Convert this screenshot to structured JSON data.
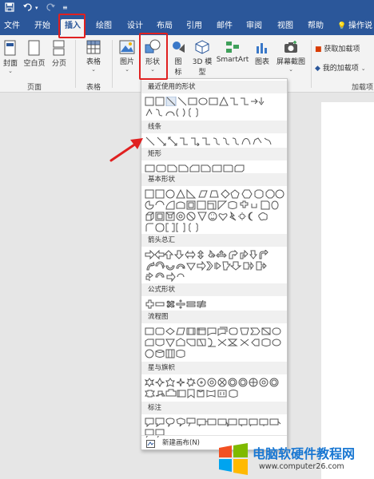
{
  "titlebar": {
    "icons": [
      "save-icon",
      "undo-icon",
      "redo-icon",
      "customize-icon"
    ]
  },
  "tabs": [
    {
      "label": "文件",
      "active": false
    },
    {
      "label": "开始",
      "active": false
    },
    {
      "label": "插入",
      "active": true
    },
    {
      "label": "绘图",
      "active": false
    },
    {
      "label": "设计",
      "active": false
    },
    {
      "label": "布局",
      "active": false
    },
    {
      "label": "引用",
      "active": false
    },
    {
      "label": "邮件",
      "active": false
    },
    {
      "label": "审阅",
      "active": false
    },
    {
      "label": "视图",
      "active": false
    },
    {
      "label": "帮助",
      "active": false
    },
    {
      "label": "操作说",
      "active": false
    }
  ],
  "ribbon": {
    "pages_group": {
      "label": "页面",
      "buttons": [
        "封面",
        "空白页",
        "分页"
      ]
    },
    "table_group": {
      "label": "表格",
      "buttons": [
        "表格"
      ]
    },
    "illustrations": {
      "picture": "图片",
      "shapes": "形状",
      "icons_line1": "图",
      "icons_line2": "标",
      "model3d_line1": "3D 模",
      "model3d_line2": "型",
      "smartart": "SmartArt",
      "chart": "图表",
      "screenshot": "屏幕截图"
    },
    "addins": {
      "label": "加载项",
      "get_addins": "获取加载项",
      "my_addins": "我的加载项"
    }
  },
  "gallery": {
    "sections": [
      {
        "label": "最近使用的形状"
      },
      {
        "label": "线条"
      },
      {
        "label": "矩形"
      },
      {
        "label": "基本形状"
      },
      {
        "label": "箭头总汇"
      },
      {
        "label": "公式形状"
      },
      {
        "label": "流程图"
      },
      {
        "label": "星与旗帜"
      },
      {
        "label": "标注"
      }
    ],
    "footer": "新建画布(N)"
  },
  "colors": {
    "ribbon_blue": "#2b579a",
    "highlight_red": "#e02020",
    "watermark_blue": "#1977d2"
  },
  "watermark": {
    "title": "电脑软硬件教程网",
    "url": "www.computer26.com"
  }
}
